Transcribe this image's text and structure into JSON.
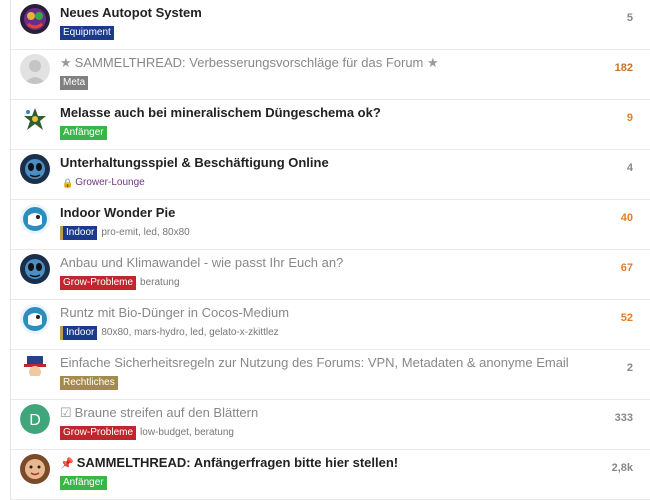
{
  "topics": [
    {
      "title": "Neues Autopot System",
      "title_style": "bold",
      "prefix_icon": null,
      "category": {
        "label": "Equipment",
        "color": "#1c3a8a",
        "style": "solid"
      },
      "tags": "",
      "count": "5",
      "count_color": "normal",
      "avatar": "avatar-colorful"
    },
    {
      "title": "SAMMELTHREAD: Verbesserungsvorschläge für das Forum",
      "title_style": "light",
      "prefix_icon": "★",
      "suffix_icon": "★",
      "category": {
        "label": "Meta",
        "color": "#808080",
        "style": "solid"
      },
      "tags": "",
      "count": "182",
      "count_color": "orange-dark",
      "avatar": "avatar-default"
    },
    {
      "title": "Melasse auch bei mineralischem Düngeschema ok?",
      "title_style": "bold",
      "prefix_icon": null,
      "category": {
        "label": "Anfänger",
        "color": "#3ab54a",
        "style": "solid"
      },
      "tags": "",
      "count": "9",
      "count_color": "orange",
      "avatar": "avatar-flower"
    },
    {
      "title": "Unterhaltungsspiel & Beschäftigung Online",
      "title_style": "bold",
      "prefix_icon": null,
      "category": {
        "label": "Grower-Lounge",
        "color": "#6c3a7d",
        "style": "locked"
      },
      "tags": "",
      "count": "4",
      "count_color": "normal",
      "avatar": "avatar-alien"
    },
    {
      "title": "Indoor Wonder Pie",
      "title_style": "bold",
      "prefix_icon": null,
      "category": {
        "label": "Indoor",
        "color": "#1c3a8a",
        "style": "bar"
      },
      "tags": "pro-emit, led, 80x80",
      "count": "40",
      "count_color": "orange",
      "avatar": "avatar-bird"
    },
    {
      "title": "Anbau und Klimawandel - wie passt Ihr Euch an?",
      "title_style": "light",
      "prefix_icon": null,
      "category": {
        "label": "Grow-Probleme",
        "color": "#c0262d",
        "style": "solid"
      },
      "tags": "beratung",
      "count": "67",
      "count_color": "orange",
      "avatar": "avatar-alien"
    },
    {
      "title": "Runtz mit Bio-Dünger in Cocos-Medium",
      "title_style": "light",
      "prefix_icon": null,
      "category": {
        "label": "Indoor",
        "color": "#1c3a8a",
        "style": "bar"
      },
      "tags": "80x80, mars-hydro, led, gelato-x-zkittlez",
      "count": "52",
      "count_color": "orange",
      "avatar": "avatar-bird"
    },
    {
      "title": "Einfache Sicherheitsregeln zur Nutzung des Forums: VPN, Metadaten & anonyme Email",
      "title_style": "light",
      "prefix_icon": null,
      "category": {
        "label": "Rechtliches",
        "color": "#a48a4c",
        "style": "solid"
      },
      "tags": "",
      "count": "2",
      "count_color": "normal",
      "avatar": "avatar-uncle-sam"
    },
    {
      "title": "Braune streifen auf den Blättern",
      "title_style": "light",
      "prefix_icon": "☑",
      "category": {
        "label": "Grow-Probleme",
        "color": "#c0262d",
        "style": "solid"
      },
      "tags": "low-budget, beratung",
      "count": "333",
      "count_color": "normal",
      "avatar": "avatar-letter-d",
      "avatar_letter": "D"
    },
    {
      "title": "SAMMELTHREAD: Anfängerfragen bitte hier stellen!",
      "title_style": "bold",
      "prefix_icon": "📌",
      "category": {
        "label": "Anfänger",
        "color": "#3ab54a",
        "style": "solid"
      },
      "tags": "",
      "count": "2,8k",
      "count_color": "normal",
      "avatar": "avatar-face"
    }
  ]
}
